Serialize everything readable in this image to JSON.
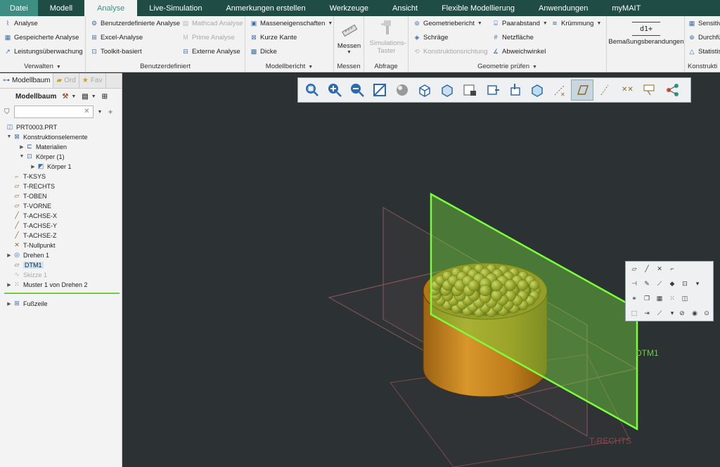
{
  "menubar": {
    "tabs": [
      "Datei",
      "Modell",
      "Analyse",
      "Live-Simulation",
      "Anmerkungen erstellen",
      "Werkzeuge",
      "Ansicht",
      "Flexible Modellierung",
      "Anwendungen",
      "myMAIT"
    ]
  },
  "ribbon": {
    "verwalten": {
      "title": "Verwalten",
      "items": [
        "Analyse",
        "Gespeicherte Analyse",
        "Leistungsüberwachung"
      ]
    },
    "benutzerdefiniert": {
      "title": "Benutzerdefiniert",
      "items": [
        "Benutzerdefinierte Analyse",
        "Excel-Analyse",
        "Toolkit-basiert",
        "Mathcad Analyse",
        "Prime Analyse",
        "Externe Analyse"
      ]
    },
    "modellbericht": {
      "title": "Modellbericht",
      "items": [
        "Masseneigenschaften",
        "Kurze Kante",
        "Dicke"
      ]
    },
    "messen": {
      "title": "Messen",
      "button": "Messen"
    },
    "abfrage": {
      "title": "Abfrage",
      "button": "Simulations-Taster"
    },
    "geometrie": {
      "title": "Geometrie prüfen",
      "items": [
        "Geometriebericht",
        "Schräge",
        "Konstruktionsrichtung",
        "Paarabstand",
        "Netzfläche",
        "Abweichwinkel",
        "Krümmung"
      ]
    },
    "bemassung": {
      "button": "Bemaßungsberandungen",
      "icon_text": "d1+"
    },
    "konstruktion": {
      "title": "Konstrukti",
      "items": [
        "Sensitiv",
        "Durchfü",
        "Statistis"
      ]
    }
  },
  "panel": {
    "tabs": [
      "Modellbaum",
      "Ord",
      "Fav"
    ],
    "header": "Modellbaum",
    "search_placeholder": "",
    "tree": [
      {
        "label": "PRT0003.PRT",
        "icon": "part-icon"
      },
      {
        "label": "Konstruktionselemente",
        "icon": "design-items-icon"
      },
      {
        "label": "Materialien",
        "icon": "folder-icon"
      },
      {
        "label": "Körper (1)",
        "icon": "bodies-icon"
      },
      {
        "label": "Körper 1",
        "icon": "body-icon"
      },
      {
        "label": "T-KSYS",
        "icon": "csys-icon"
      },
      {
        "label": "T-RECHTS",
        "icon": "datum-plane-icon"
      },
      {
        "label": "T-OBEN",
        "icon": "datum-plane-icon"
      },
      {
        "label": "T-VORNE",
        "icon": "datum-plane-icon"
      },
      {
        "label": "T-ACHSE-X",
        "icon": "axis-icon"
      },
      {
        "label": "T-ACHSE-Y",
        "icon": "axis-icon"
      },
      {
        "label": "T-ACHSE-Z",
        "icon": "axis-icon"
      },
      {
        "label": "T-Nullpunkt",
        "icon": "point-icon"
      },
      {
        "label": "Drehen 1",
        "icon": "revolve-icon"
      },
      {
        "label": "DTM1",
        "icon": "datum-plane-icon"
      },
      {
        "label": "Skizze 1",
        "icon": "sketch-icon"
      },
      {
        "label": "Muster 1 von Drehen 2",
        "icon": "pattern-icon"
      },
      {
        "label": "Fußzeile",
        "icon": "footer-icon"
      }
    ]
  },
  "viewport": {
    "dtm_label": "DTM1",
    "plane_label": "T-RECHTS"
  },
  "colors": {
    "accent": "#3e8f83",
    "menubar": "#1f4d46",
    "datum_green": "#6ccf3a",
    "part": "#c8861e"
  }
}
